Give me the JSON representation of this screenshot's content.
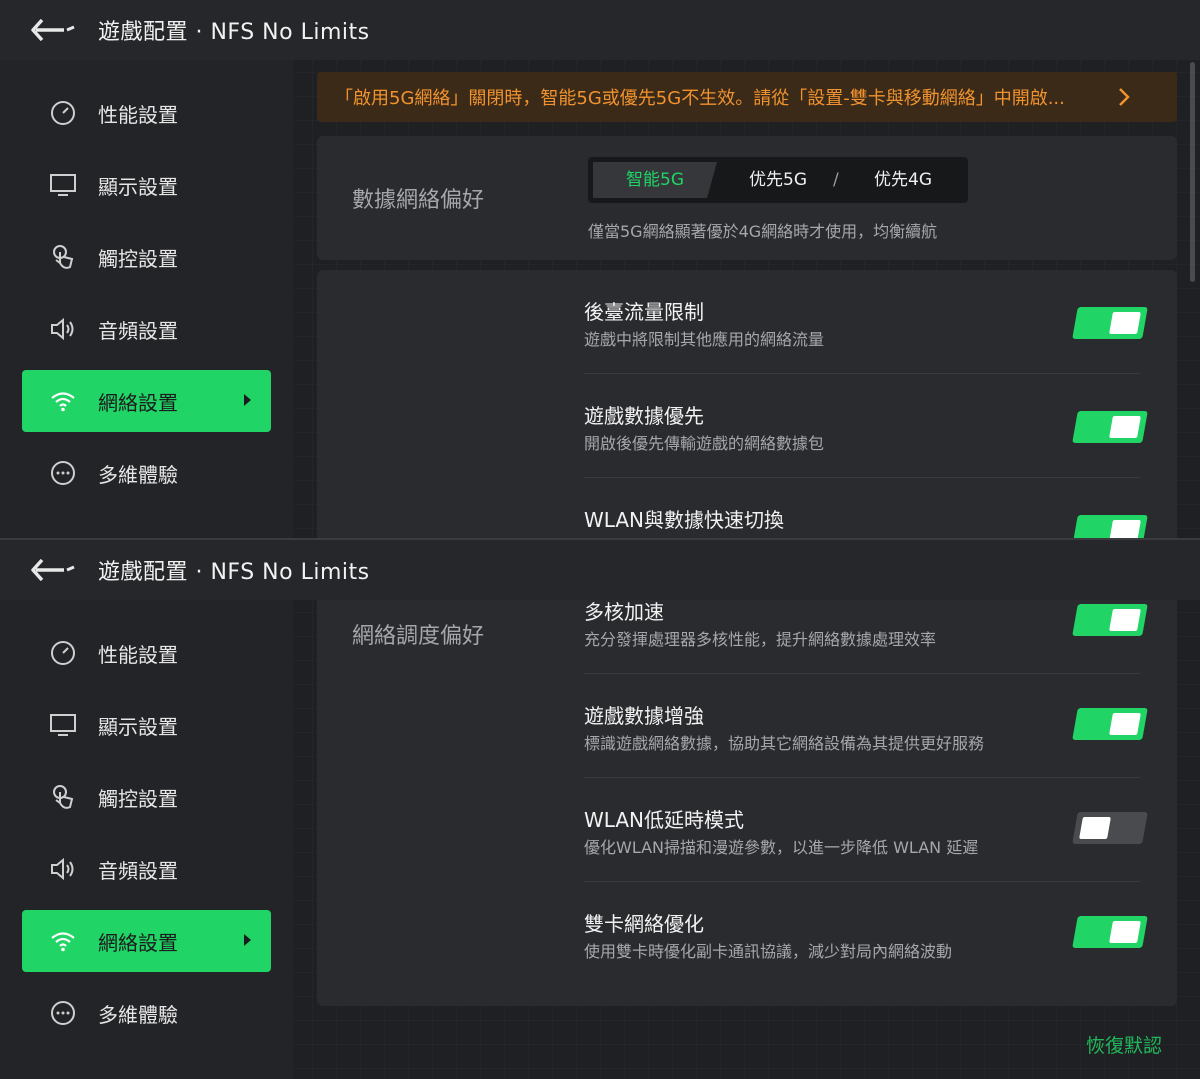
{
  "header": {
    "title": "遊戲配置 · NFS No Limits",
    "back_icon": "back-arrow-icon"
  },
  "sidebar": {
    "items": [
      {
        "label": "性能設置",
        "icon": "gauge-icon"
      },
      {
        "label": "顯示設置",
        "icon": "monitor-icon"
      },
      {
        "label": "觸控設置",
        "icon": "touch-icon"
      },
      {
        "label": "音頻設置",
        "icon": "speaker-icon"
      },
      {
        "label": "網絡設置",
        "icon": "wifi-icon",
        "active": true
      },
      {
        "label": "多維體驗",
        "icon": "more-icon"
      }
    ]
  },
  "banner": {
    "text": "「啟用5G網絡」關閉時，智能5G或優先5G不生效。請從「設置-雙卡與移動網絡」中開啟...",
    "icon": "chevron-right-icon"
  },
  "data_pref": {
    "label": "數據網絡偏好",
    "options": [
      "智能5G",
      "优先5G",
      "优先4G"
    ],
    "separator": "/",
    "selected": "智能5G",
    "hint": "僅當5G網絡顯著優於4G網絡時才使用，均衡續航"
  },
  "top_rows": [
    {
      "title": "後臺流量限制",
      "desc": "遊戲中將限制其他應用的網絡流量",
      "on": true
    },
    {
      "title": "遊戲數據優先",
      "desc": "開啟後優先傳輸遊戲的網絡數據包",
      "on": true
    },
    {
      "title": "WLAN與數據快速切換",
      "desc": "",
      "on": true
    }
  ],
  "sched_pref": {
    "label": "網絡調度偏好"
  },
  "bottom_rows": [
    {
      "title": "多核加速",
      "desc": "充分發揮處理器多核性能，提升網絡數據處理效率",
      "on": true
    },
    {
      "title": "遊戲數據增強",
      "desc": "標識遊戲網絡數據，協助其它網絡設備為其提供更好服務",
      "on": true
    },
    {
      "title": "WLAN低延時模式",
      "desc": "優化WLAN掃描和漫遊參數，以進一步降低 WLAN 延遲",
      "on": false
    },
    {
      "title": "雙卡網絡優化",
      "desc": "使用雙卡時優化副卡通訊協議，減少對局內網絡波動",
      "on": true
    }
  ],
  "restore_label": "恢復默認",
  "colors": {
    "accent": "#20d466",
    "warning": "#f0922f",
    "banner_bg": "#3b2a17"
  }
}
